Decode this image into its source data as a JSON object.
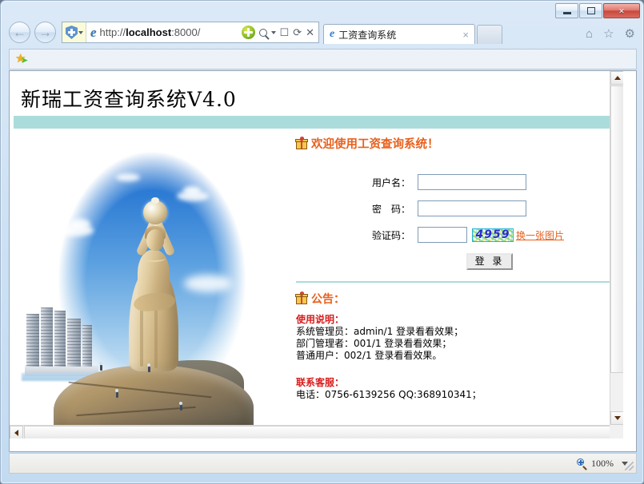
{
  "browser": {
    "window_controls": {
      "minimize": "–",
      "maximize": "□",
      "close": "×"
    },
    "back_label": "←",
    "forward_label": "→",
    "url": "http://localhost:8000/",
    "url_host": "localhost",
    "url_scheme": "http://",
    "url_port_path": ":8000/",
    "address_icons": [
      "compatibility-view-icon",
      "search-icon",
      "dropdown-caret",
      "feeds-icon",
      "refresh-icon",
      "stop-icon"
    ],
    "tab": {
      "title": "工资查询系统",
      "close": "×"
    },
    "toolbar_icons": [
      "home-icon",
      "favorites-star-icon",
      "tools-gear-icon"
    ],
    "favorites_bar": {
      "icon": "favorites-add-star-icon"
    },
    "status": {
      "zoom": "100%"
    }
  },
  "page": {
    "site_title": "新瑞工资查询系统V4.0",
    "welcome": "欢迎使用工资查询系统！",
    "form": {
      "username_label": "用户名：",
      "username_value": "",
      "password_label": "密　码：",
      "password_value": "",
      "captcha_label": "验证码：",
      "captcha_value": "",
      "captcha_image_text": "4959",
      "refresh_link": "换一张图片",
      "login_button": "登 录"
    },
    "notice": {
      "heading": "公告：",
      "usage_heading": "使用说明：",
      "usage_lines": [
        "系统管理员：admin/1 登录看看效果；",
        "部门管理者：001/1 登录看看效果；",
        "普通用户：002/1 登录看看效果。"
      ],
      "contact_heading": "联系客服：",
      "contact_line": "电话：0756-6139256 QQ:368910341；"
    },
    "hero_image_alt": "珠海渔女雕像"
  },
  "colors": {
    "teal_bar": "#abdcdc",
    "accent_orange": "#e8601c",
    "accent_red": "#d81c1c",
    "input_border": "#7f9bb5",
    "captcha_text": "#2a2ad0"
  }
}
